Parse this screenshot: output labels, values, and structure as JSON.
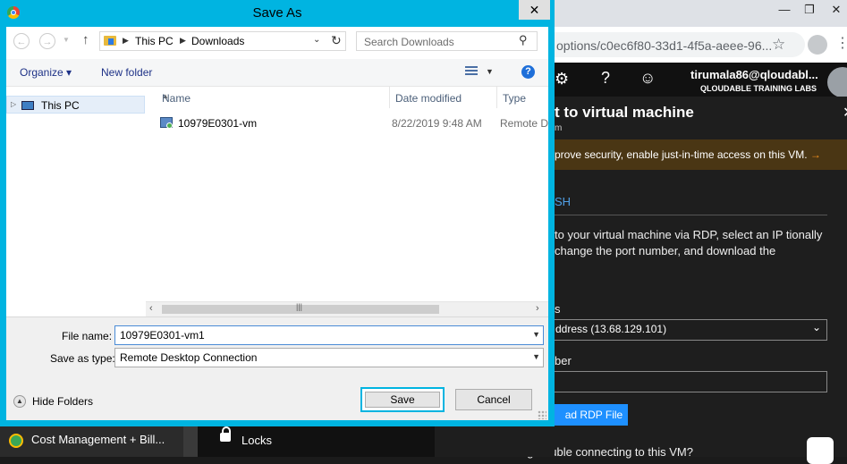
{
  "dialog": {
    "title": "Save As",
    "breadcrumb": [
      "This PC",
      "Downloads"
    ],
    "search_placeholder": "Search Downloads",
    "toolbar": {
      "organize": "Organize",
      "new_folder": "New folder"
    },
    "nav": {
      "this_pc": "This PC"
    },
    "columns": {
      "name": "Name",
      "date_modified": "Date modified",
      "type": "Type"
    },
    "files": [
      {
        "name": "10979E0301-vm",
        "date": "8/22/2019 9:48 AM",
        "type": "Remote Desktop Connection"
      }
    ],
    "file_name_label": "File name:",
    "file_name_value": "10979E0301-vm1",
    "save_as_type_label": "Save as type:",
    "save_as_type_value": "Remote Desktop Connection",
    "hide_folders": "Hide Folders",
    "save": "Save",
    "cancel": "Cancel",
    "close_glyph": "✕"
  },
  "browser": {
    "address_fragment": "options/c0ec6f80-33d1-4f5a-aeee-96...",
    "user_email": "tirumala86@qloudabl...",
    "user_org": "QLOUDABLE TRAINING LABS",
    "pane_title": "t to virtual machine",
    "pane_sub": "m",
    "warning": "prove security, enable just-in-time access on this VM.",
    "warning_arrow": "→",
    "tab": "SH",
    "description": "to your virtual machine via RDP, select an IP tionally change the port number, and download the",
    "ip_label": "s",
    "ip_value": "ddress (13.68.129.101)",
    "port_label": "ber",
    "download_button": "ad RDP File",
    "trouble": "Having trouble connecting to this VM?"
  },
  "taskbar": {
    "item1": "Cost Management + Bill...",
    "item2": "Locks"
  },
  "colors": {
    "dialog_frame": "#00b4e1",
    "portal_bg": "#1e1e1e",
    "accent_blue": "#1e90ff",
    "warning_arrow": "#f7931e"
  },
  "icons": [
    "chrome-icon",
    "close-icon",
    "back-arrow-icon",
    "forward-arrow-icon",
    "up-arrow-icon",
    "folder-icon",
    "refresh-icon",
    "search-icon",
    "view-options-icon",
    "help-icon",
    "this-pc-icon",
    "rdp-file-icon",
    "gear-icon",
    "question-icon",
    "smiley-icon",
    "star-icon",
    "lock-icon"
  ]
}
